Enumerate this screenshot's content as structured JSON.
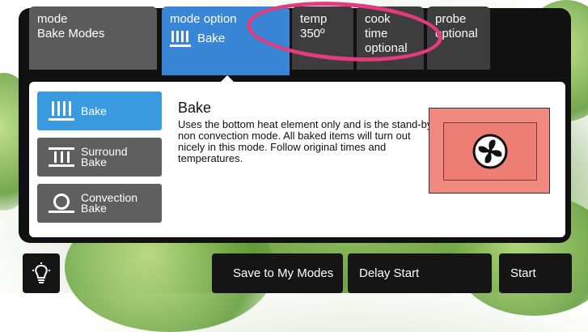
{
  "tabs": [
    {
      "label": "mode",
      "value": "Bake Modes"
    },
    {
      "label": "mode option",
      "value": "Bake"
    },
    {
      "label": "temp",
      "value": "350º"
    },
    {
      "label": "cook time",
      "value": "optional"
    },
    {
      "label": "probe",
      "value": "optional"
    }
  ],
  "options": [
    {
      "label": "Bake",
      "selected": true,
      "icon": "bake-icon"
    },
    {
      "label": "Surround Bake",
      "selected": false,
      "icon": "surround-bake-icon"
    },
    {
      "label": "Convection Bake",
      "selected": false,
      "icon": "convection-bake-icon"
    }
  ],
  "description": {
    "title": "Bake",
    "text": "Uses the bottom heat element only and is the stand-by, non convection mode. All baked items will turn out nicely in this mode. Follow original times and temperatures."
  },
  "bottom": {
    "light_icon": "light-bulb-icon",
    "save": "Save to My Modes",
    "delay": "Delay Start",
    "start": "Start"
  },
  "colors": {
    "active_tab": "#3a86d6",
    "selected_option": "#3a9be0",
    "highlight": "#e33b7c",
    "preview": "#f08a80"
  }
}
